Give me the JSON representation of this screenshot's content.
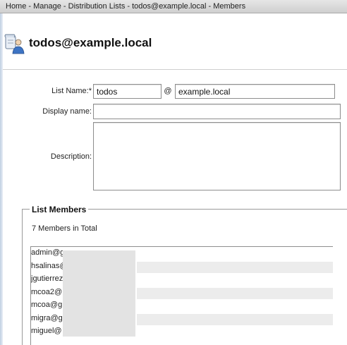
{
  "breadcrumb": "Home - Manage - Distribution Lists - todos@example.local - Members",
  "page_title": "todos@example.local",
  "form": {
    "list_name_label": "List Name:*",
    "list_name_value": "todos",
    "at_sign": "@",
    "domain_value": "example.local",
    "display_name_label": "Display name:",
    "display_name_value": "",
    "description_label": "Description:",
    "description_value": ""
  },
  "members": {
    "legend": "List Members",
    "count_text": "7 Members in Total",
    "items": [
      "admin@g",
      "hsalinas@",
      "jgutierrez",
      "mcoa2@",
      "mcoa@g",
      "migra@g",
      "miguel@"
    ]
  }
}
